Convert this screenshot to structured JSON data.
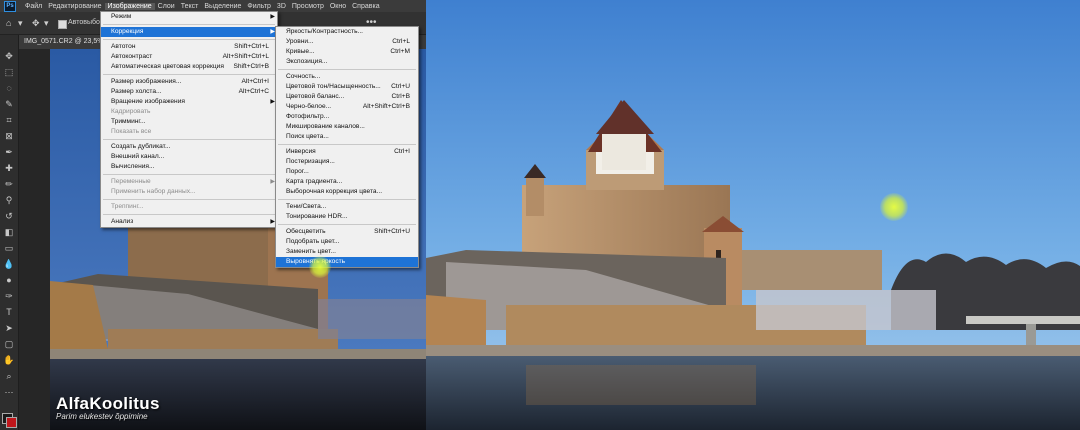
{
  "menubar": {
    "logo": "Ps",
    "items": [
      "Файл",
      "Редактирование",
      "Изображение",
      "Слои",
      "Текст",
      "Выделение",
      "Фильтр",
      "3D",
      "Просмотр",
      "Окно",
      "Справка"
    ]
  },
  "options": {
    "auto_label": "Автовыбор"
  },
  "document_tab": {
    "title": "IMG_0571.CR2 @ 23,5% ("
  },
  "image_menu": {
    "groups": [
      [
        {
          "label": "Режим",
          "sc": "",
          "arrow": true
        }
      ],
      [
        {
          "label": "Коррекция",
          "sc": "",
          "arrow": true,
          "hl": true
        }
      ],
      [
        {
          "label": "Автотон",
          "sc": "Shift+Ctrl+L"
        },
        {
          "label": "Автоконтраст",
          "sc": "Alt+Shift+Ctrl+L"
        },
        {
          "label": "Автоматическая цветовая коррекция",
          "sc": "Shift+Ctrl+B"
        }
      ],
      [
        {
          "label": "Размер изображения...",
          "sc": "Alt+Ctrl+I"
        },
        {
          "label": "Размер холста...",
          "sc": "Alt+Ctrl+C"
        },
        {
          "label": "Вращение изображения",
          "sc": "",
          "arrow": true
        },
        {
          "label": "Кадрировать",
          "sc": "",
          "dis": true
        },
        {
          "label": "Тримминг...",
          "sc": ""
        },
        {
          "label": "Показать все",
          "sc": "",
          "dis": true
        }
      ],
      [
        {
          "label": "Создать дубликат...",
          "sc": ""
        },
        {
          "label": "Внешний канал...",
          "sc": ""
        },
        {
          "label": "Вычисления...",
          "sc": ""
        }
      ],
      [
        {
          "label": "Переменные",
          "sc": "",
          "arrow": true,
          "dis": true
        },
        {
          "label": "Применить набор данных...",
          "sc": "",
          "dis": true
        }
      ],
      [
        {
          "label": "Треппинг...",
          "sc": "",
          "dis": true
        }
      ],
      [
        {
          "label": "Анализ",
          "sc": "",
          "arrow": true
        }
      ]
    ]
  },
  "adjust_menu": {
    "groups": [
      [
        {
          "label": "Яркость/Контрастность...",
          "sc": ""
        },
        {
          "label": "Уровни...",
          "sc": "Ctrl+L"
        },
        {
          "label": "Кривые...",
          "sc": "Ctrl+M"
        },
        {
          "label": "Экспозиция...",
          "sc": ""
        }
      ],
      [
        {
          "label": "Сочность...",
          "sc": ""
        },
        {
          "label": "Цветовой тон/Насыщенность...",
          "sc": "Ctrl+U"
        },
        {
          "label": "Цветовой баланс...",
          "sc": "Ctrl+B"
        },
        {
          "label": "Черно-белое...",
          "sc": "Alt+Shift+Ctrl+B"
        },
        {
          "label": "Фотофильтр...",
          "sc": ""
        },
        {
          "label": "Микширование каналов...",
          "sc": ""
        },
        {
          "label": "Поиск цвета...",
          "sc": ""
        }
      ],
      [
        {
          "label": "Инверсия",
          "sc": "Ctrl+I"
        },
        {
          "label": "Постеризация...",
          "sc": ""
        },
        {
          "label": "Порог...",
          "sc": ""
        },
        {
          "label": "Карта градиента...",
          "sc": ""
        },
        {
          "label": "Выборочная коррекция цвета...",
          "sc": ""
        }
      ],
      [
        {
          "label": "Тени/Света...",
          "sc": ""
        },
        {
          "label": "Тонирование HDR...",
          "sc": ""
        }
      ],
      [
        {
          "label": "Обесцветить",
          "sc": "Shift+Ctrl+U"
        },
        {
          "label": "Подобрать цвет...",
          "sc": ""
        },
        {
          "label": "Заменить цвет...",
          "sc": ""
        },
        {
          "label": "Выровнять яркость",
          "sc": "",
          "hl": true
        }
      ]
    ]
  },
  "watermark": {
    "brand": "AlfaKoolitus",
    "slogan": "Parim elukestev õppimine"
  }
}
